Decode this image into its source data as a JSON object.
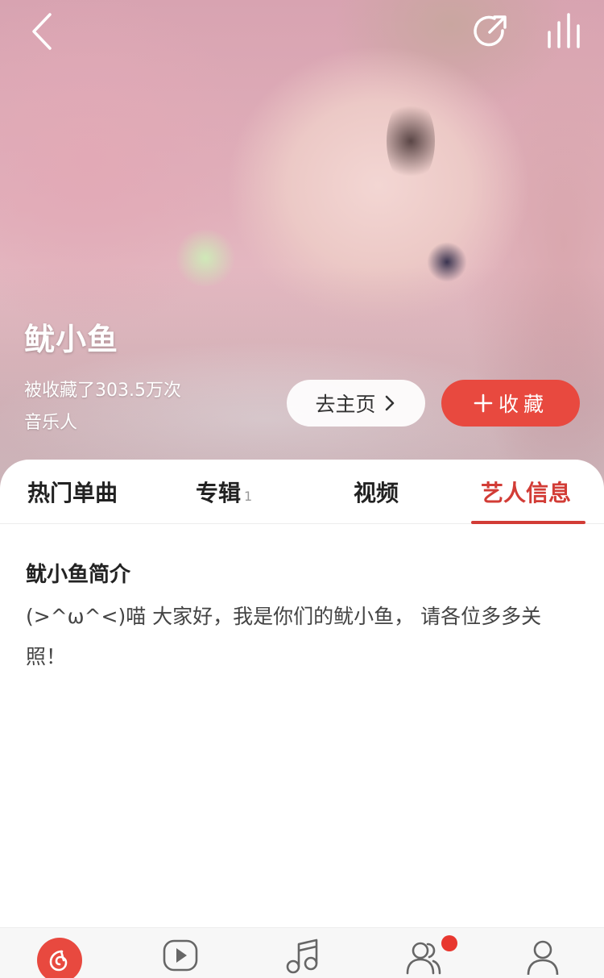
{
  "header": {
    "back_icon": "chevron-left-icon",
    "share_icon": "share-icon",
    "equalizer_icon": "equalizer-icon"
  },
  "artist": {
    "name": "鱿小鱼",
    "favorited_text": "被收藏了303.5万次",
    "role": "音乐人"
  },
  "actions": {
    "home_label": "去主页",
    "favorite_label": "收藏"
  },
  "tabs": [
    {
      "label": "热门单曲",
      "count": ""
    },
    {
      "label": "专辑",
      "count": "1"
    },
    {
      "label": "视频",
      "count": ""
    },
    {
      "label": "艺人信息",
      "count": ""
    }
  ],
  "active_tab": "艺人信息",
  "intro": {
    "title": "鱿小鱼简介",
    "text": "(>^ω^<)喵 大家好，我是你们的鱿小鱼， 请各位多多关照！"
  },
  "bottom_nav": [
    {
      "icon": "netease-music-logo-icon"
    },
    {
      "icon": "video-play-icon"
    },
    {
      "icon": "music-note-icon"
    },
    {
      "icon": "friends-icon",
      "has_badge": true
    },
    {
      "icon": "profile-icon"
    }
  ],
  "colors": {
    "accent": "#e8493f",
    "active_tab": "#d23c36"
  }
}
